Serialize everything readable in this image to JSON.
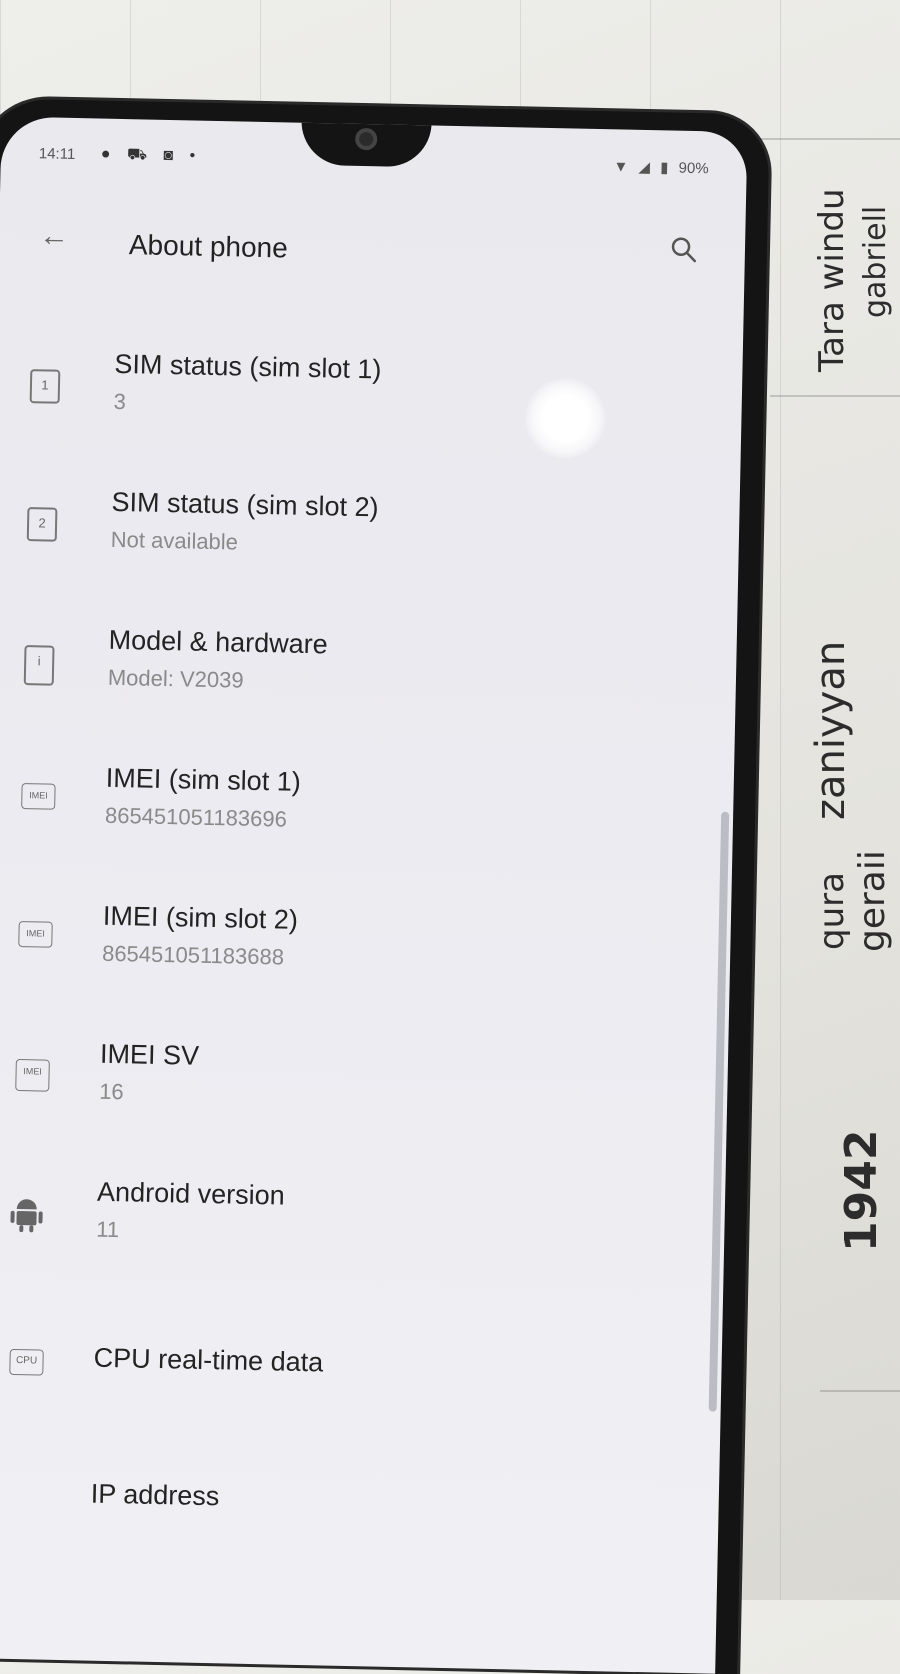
{
  "background": {
    "handwriting": [
      "Tara windu",
      "gabriell",
      "zaniyyan",
      "qura",
      "geraii",
      "1942"
    ]
  },
  "statusbar": {
    "time": "14:11",
    "left_icons": "● ⛟ ◙ •",
    "battery": "90%"
  },
  "appbar": {
    "back_glyph": "←",
    "title": "About phone"
  },
  "items": [
    {
      "icon": "1",
      "title": "SIM status (sim slot 1)",
      "subtitle": "3"
    },
    {
      "icon": "2",
      "title": "SIM status (sim slot 2)",
      "subtitle": "Not available"
    },
    {
      "icon": "i",
      "title": "Model & hardware",
      "subtitle": "Model: V2039"
    },
    {
      "icon": "IMEI",
      "title": "IMEI (sim slot 1)",
      "subtitle": "865451051183696"
    },
    {
      "icon": "IMEI",
      "title": "IMEI (sim slot 2)",
      "subtitle": "865451051183688"
    },
    {
      "icon": "IMEI",
      "title": "IMEI SV",
      "subtitle": "16"
    },
    {
      "icon": "android",
      "title": "Android version",
      "subtitle": "11"
    },
    {
      "icon": "CPU",
      "title": "CPU real-time data",
      "subtitle": ""
    },
    {
      "icon": "",
      "title": "IP address",
      "subtitle": ""
    }
  ]
}
